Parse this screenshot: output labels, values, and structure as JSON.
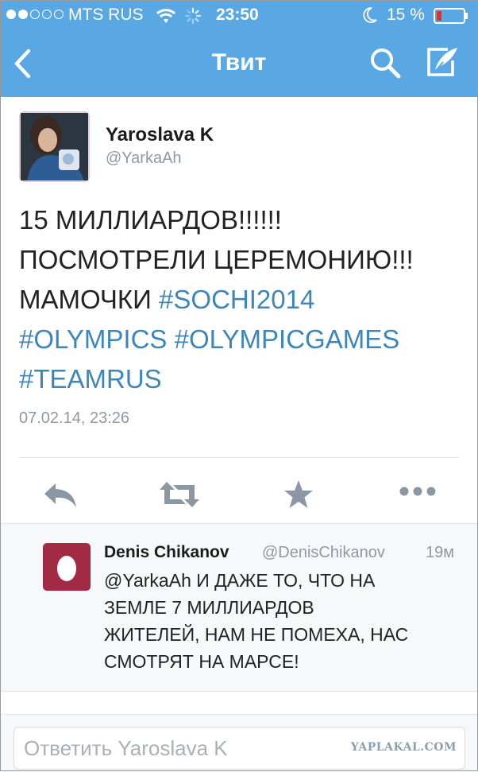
{
  "status_bar": {
    "carrier": "MTS RUS",
    "time": "23:50",
    "battery_percent": "15 %",
    "signal_bars_filled": 2,
    "signal_bars_total": 5
  },
  "nav": {
    "title": "Твит",
    "back_icon": "chevron-left-icon",
    "search_icon": "search-icon",
    "compose_icon": "compose-tweet-icon"
  },
  "tweet": {
    "author_name": "Yaroslava K",
    "author_handle": "@YarkaAh",
    "text_line1": "15 МИЛЛИАРДОВ!!!!!!",
    "text_line2": "ПОСМОТРЕЛИ ЦЕРЕМОНИЮ!!!",
    "text_line3_plain": "МАМОЧКИ ",
    "hashtags": [
      "#SOCHI2014",
      "#OLYMPICS",
      "#OLYMPICGAMES",
      "#TEAMRUS"
    ],
    "timestamp": "07.02.14, 23:26"
  },
  "actions": [
    "reply-icon",
    "retweet-icon",
    "favorite-star-icon",
    "more-dots-icon"
  ],
  "reply": {
    "author_name": "Denis Chikanov",
    "author_handle": "@DenisChikanov",
    "time": "19м",
    "text_line1": "@YarkaAh И ДАЖЕ ТО, ЧТО НА",
    "text_line2": "ЗЕМЛЕ 7 МИЛЛИАРДОВ",
    "text_line3": "ЖИТЕЛЕЙ, НАМ НЕ ПОМЕХА, НАС",
    "text_line4": "СМОТРЯТ НА МАРСЕ!"
  },
  "composer": {
    "placeholder": "Ответить Yaroslava K"
  },
  "watermark": "YAPLAKAL.COM",
  "colors": {
    "header_blue": "#59a8e3",
    "hashtag_blue": "#3f86b8",
    "battery_red": "#e0312f",
    "reply_avatar": "#a32a45"
  }
}
